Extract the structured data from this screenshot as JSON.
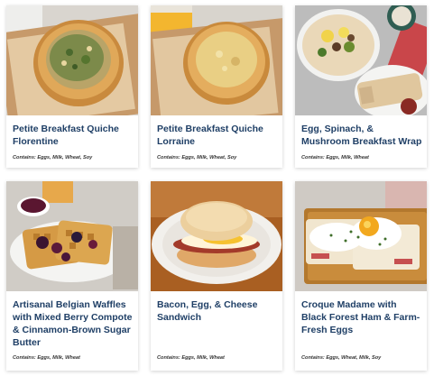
{
  "cards": [
    {
      "title": "Petite Breakfast Quiche Florentine",
      "allergens": "Contains: Eggs, Milk, Wheat, Soy",
      "image": "quiche-florentine"
    },
    {
      "title": "Petite Breakfast Quiche Lorraine",
      "allergens": "Contains: Eggs, Milk, Wheat, Soy",
      "image": "quiche-lorraine"
    },
    {
      "title": "Egg, Spinach, & Mushroom Breakfast Wrap",
      "allergens": "Contains: Eggs, Milk, Wheat",
      "image": "breakfast-wrap"
    },
    {
      "title": "Artisanal Belgian Waffles with Mixed Berry Compote & Cinnamon-Brown Sugar Butter",
      "allergens": "Contains: Eggs, Milk, Wheat",
      "image": "belgian-waffles"
    },
    {
      "title": "Bacon, Egg, & Cheese Sandwich",
      "allergens": "Contains: Eggs, Milk, Wheat",
      "image": "breakfast-sandwich"
    },
    {
      "title": "Croque Madame with Black Forest Ham & Farm-Fresh Eggs",
      "allergens": "Contains: Eggs, Wheat, Milk, Soy",
      "image": "croque-madame"
    }
  ],
  "colors": {
    "title": "#1f3f66",
    "text": "#333333",
    "card_bg": "#ffffff"
  }
}
